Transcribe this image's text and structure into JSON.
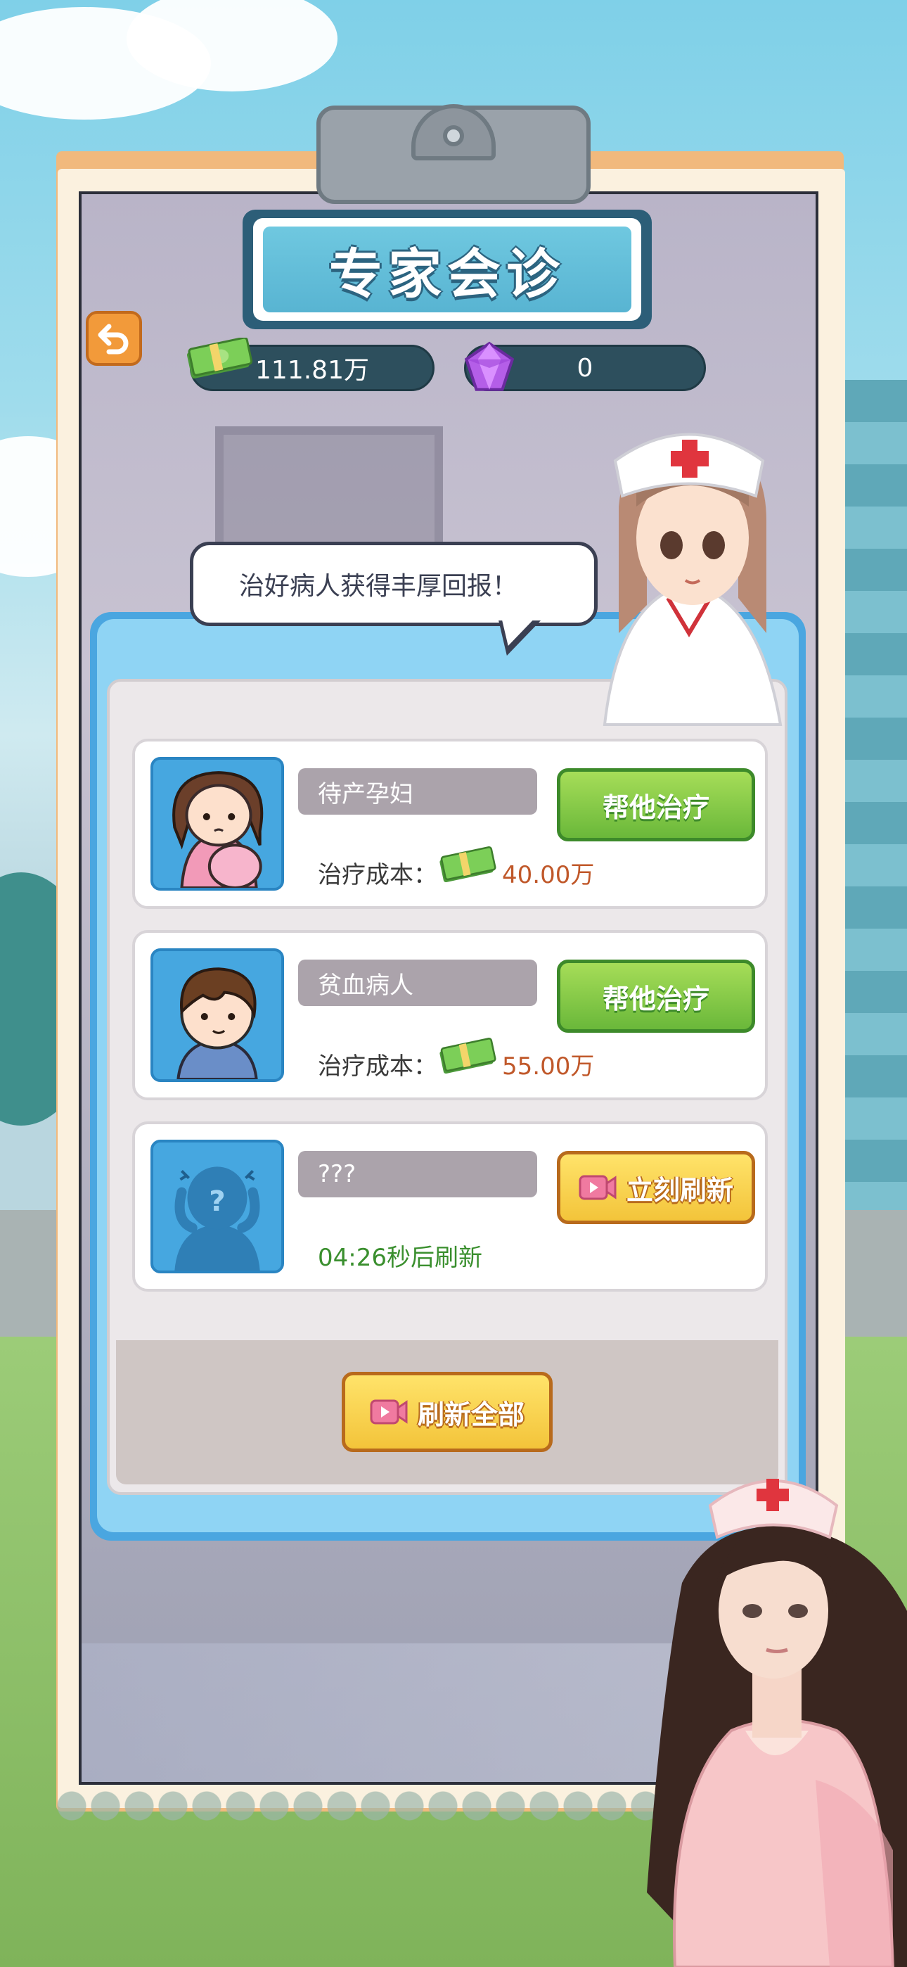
{
  "header": {
    "title": "专家会诊"
  },
  "currency": {
    "cash": "111.81万",
    "gems": "0"
  },
  "speech": {
    "text": "治好病人获得丰厚回报！"
  },
  "patients": [
    {
      "name": "待产孕妇",
      "cost_label": "治疗成本：",
      "cost": "40.00万",
      "button": "帮他治疗"
    },
    {
      "name": "贫血病人",
      "cost_label": "治疗成本：",
      "cost": "55.00万",
      "button": "帮他治疗"
    },
    {
      "name": "???",
      "timer": "04:26秒后刷新",
      "button": "立刻刷新"
    }
  ],
  "footer": {
    "refresh_all": "刷新全部"
  },
  "colors": {
    "accent_green": "#6ab83a",
    "accent_yellow": "#f3c43a",
    "cost_red": "#c0582a",
    "timer_green": "#3a8f2e",
    "panel_blue": "#4aa6e0"
  },
  "icons": [
    "back-arrow-icon",
    "cash-icon",
    "gem-icon",
    "video-icon",
    "question-silhouette-icon"
  ]
}
